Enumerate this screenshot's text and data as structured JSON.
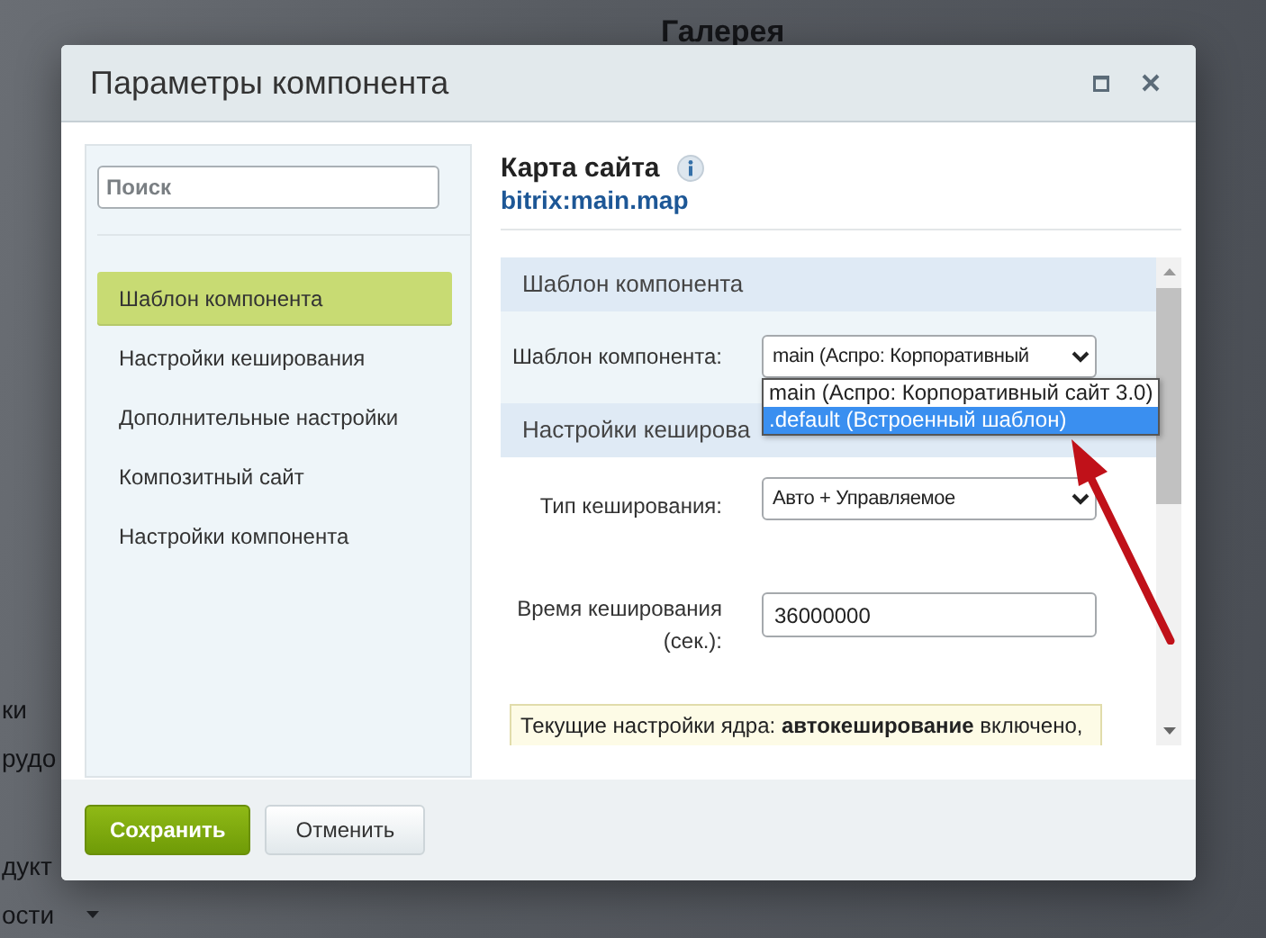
{
  "background_page": {
    "heading": "Галерея",
    "menu_fragments": [
      {
        "label": "ки",
        "caret": false
      },
      {
        "label": "рудо",
        "caret": false
      },
      {
        "label": "дукт",
        "caret": false
      },
      {
        "label": "ости",
        "caret": true
      }
    ]
  },
  "dialog": {
    "title": "Параметры компонента"
  },
  "sidebar": {
    "search": {
      "placeholder": "Поиск"
    },
    "items": [
      {
        "label": "Шаблон компонента",
        "selected": true
      },
      {
        "label": "Настройки кеширования",
        "selected": false
      },
      {
        "label": "Дополнительные настройки",
        "selected": false
      },
      {
        "label": "Композитный сайт",
        "selected": false
      },
      {
        "label": "Настройки компонента",
        "selected": false
      }
    ]
  },
  "component": {
    "title": "Карта сайта",
    "code": "bitrix:main.map"
  },
  "sections": [
    {
      "title": "Шаблон компонента",
      "fields": [
        {
          "kind": "select",
          "label": "Шаблон компонента:",
          "value": "main (Аспро: Корпоративный"
        }
      ]
    },
    {
      "title": "Настройки кеширова",
      "fields": [
        {
          "kind": "select",
          "label": "Тип кеширования:",
          "value": "Авто + Управляемое"
        },
        {
          "kind": "text",
          "label": "Время кеширования (сек.):",
          "value": "36000000"
        },
        {
          "kind": "note",
          "text": "Текущие настройки ядра: **автокеширование** включено,"
        }
      ]
    }
  ],
  "dropdown": {
    "options": [
      {
        "label": "main (Аспро: Корпоративный сайт 3.0)",
        "selected": false
      },
      {
        "label": ".default (Встроенный шаблон)",
        "selected": true
      }
    ]
  },
  "buttons": [
    {
      "label": "Сохранить",
      "kind": "primary"
    },
    {
      "label": "Отменить",
      "kind": "secondary"
    }
  ]
}
